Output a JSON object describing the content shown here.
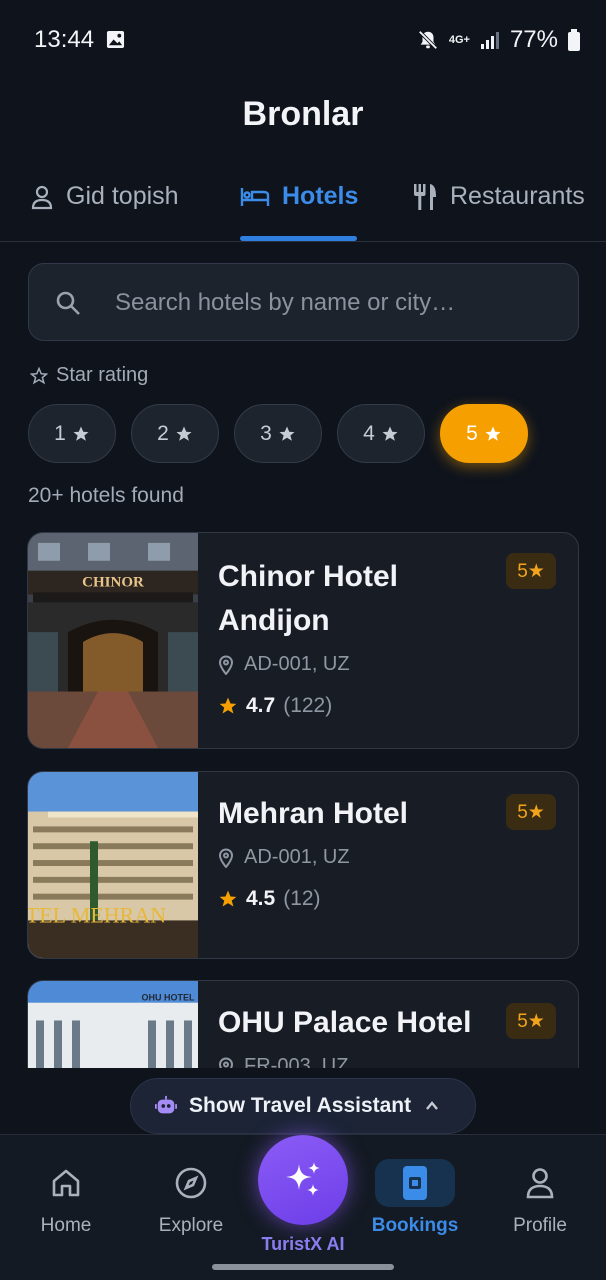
{
  "status_bar": {
    "time": "13:44",
    "network": "4G+",
    "battery": "77%"
  },
  "header": {
    "title": "Bronlar"
  },
  "tabs": [
    {
      "label": "Gid topish",
      "icon": "person-icon",
      "active": false
    },
    {
      "label": "Hotels",
      "icon": "bed-icon",
      "active": true
    },
    {
      "label": "Restaurants",
      "icon": "fork-knife-icon",
      "active": false
    }
  ],
  "search": {
    "placeholder": "Search hotels by name or city…",
    "value": ""
  },
  "filter": {
    "label": "Star rating",
    "chips": [
      {
        "label": "1",
        "selected": false
      },
      {
        "label": "2",
        "selected": false
      },
      {
        "label": "3",
        "selected": false
      },
      {
        "label": "4",
        "selected": false
      },
      {
        "label": "5",
        "selected": true
      }
    ]
  },
  "results": {
    "count_text": "20+ hotels found"
  },
  "hotels": [
    {
      "name": "Chinor Hotel Andijon",
      "location": "AD-001, UZ",
      "rating": "4.7",
      "reviews": "(122)",
      "badge": "5★",
      "image_sign": "CHINOR"
    },
    {
      "name": "Mehran Hotel",
      "location": "AD-001, UZ",
      "rating": "4.5",
      "reviews": "(12)",
      "badge": "5★",
      "image_sign": "OTEL MEHRAN"
    },
    {
      "name": "OHU Palace Hotel",
      "location": "FR-003, UZ",
      "rating": "",
      "reviews": "",
      "badge": "5★",
      "image_sign": "OHU HOTEL"
    }
  ],
  "assistant": {
    "label": "Show Travel Assistant"
  },
  "bottom_nav": {
    "items": [
      {
        "label": "Home",
        "icon": "home-icon"
      },
      {
        "label": "Explore",
        "icon": "compass-icon"
      },
      {
        "label": "TuristX AI",
        "icon": "sparkles-icon"
      },
      {
        "label": "Bookings",
        "icon": "booking-icon",
        "active": true
      },
      {
        "label": "Profile",
        "icon": "profile-icon"
      }
    ]
  },
  "colors": {
    "accent": "#3b8be8",
    "star": "#f5a000",
    "ai": "#8b5cf6",
    "background": "#0e131c"
  }
}
